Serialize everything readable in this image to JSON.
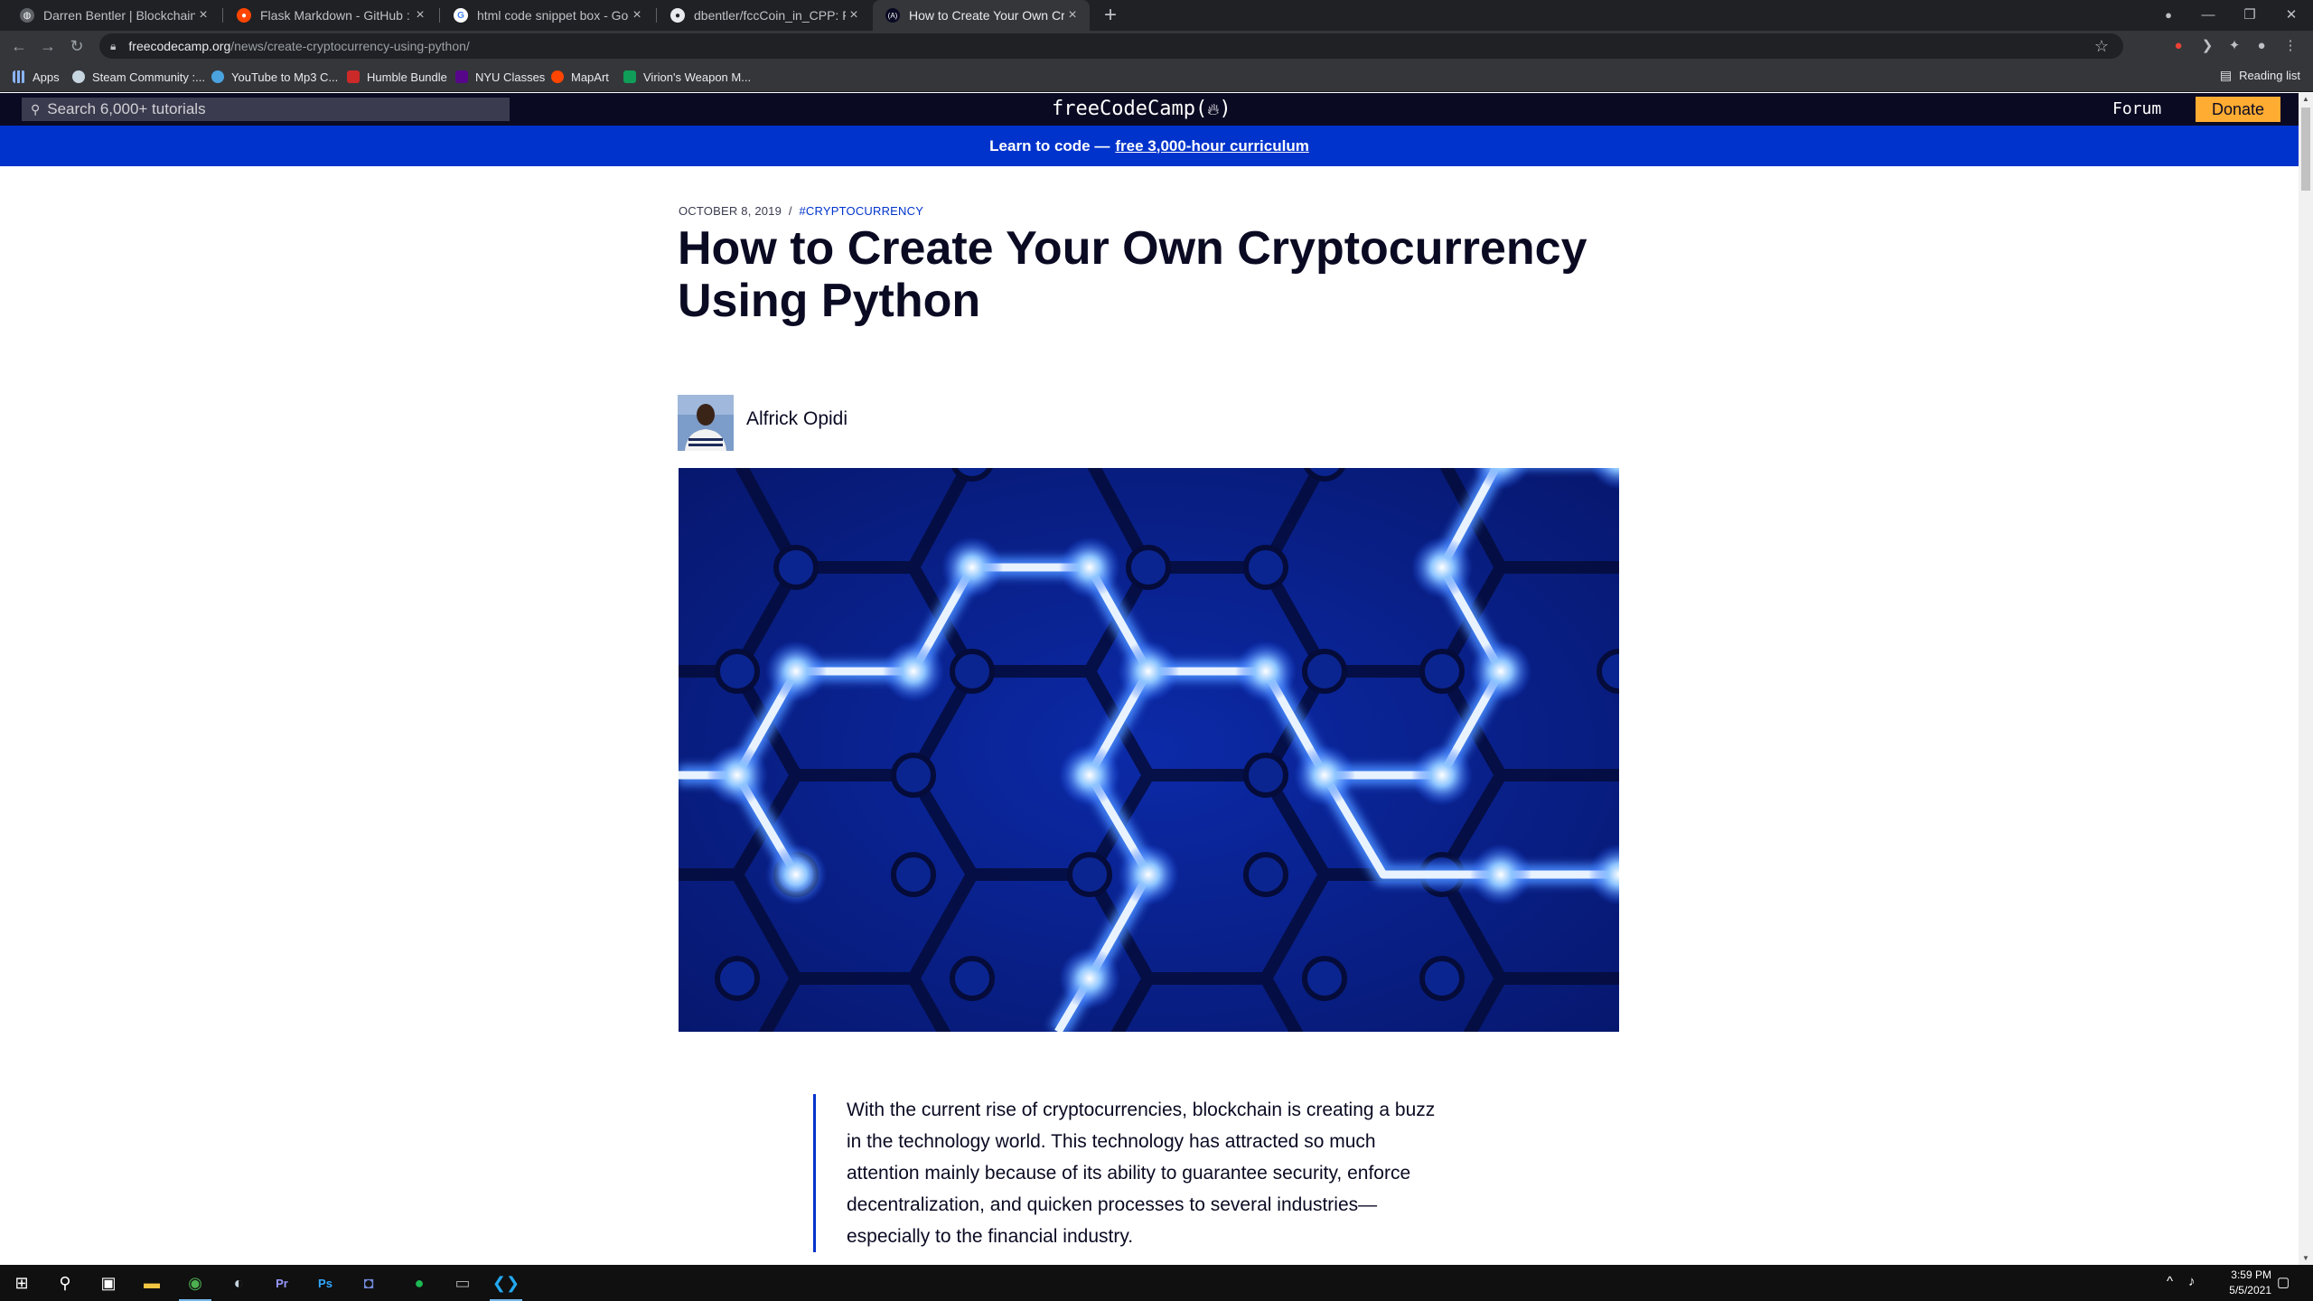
{
  "browser": {
    "tabs": [
      {
        "title": "Darren Bentler | Blockchain",
        "icon": "globe-icon"
      },
      {
        "title": "Flask Markdown - GitHub : flask",
        "icon": "reddit-icon"
      },
      {
        "title": "html code snippet box - Google",
        "icon": "google-icon"
      },
      {
        "title": "dbentler/fccCoin_in_CPP: Free Co",
        "icon": "github-icon"
      },
      {
        "title": "How to Create Your Own Crypto",
        "icon": "fcc-icon"
      }
    ],
    "url_host": "freecodecamp.org",
    "url_path": "/news/create-cryptocurrency-using-python/",
    "bookmarks": [
      {
        "label": "Apps",
        "icon": "apps-grid-icon"
      },
      {
        "label": "Steam Community :...",
        "icon": "steam-icon"
      },
      {
        "label": "YouTube to Mp3 C...",
        "icon": "youtube-mp3-icon"
      },
      {
        "label": "Humble Bundle",
        "icon": "humble-bundle-icon"
      },
      {
        "label": "NYU Classes",
        "icon": "nyu-icon"
      },
      {
        "label": "MapArt",
        "icon": "reddit-icon"
      },
      {
        "label": "Virion's Weapon M...",
        "icon": "sheets-icon"
      }
    ],
    "reading_list": "Reading list"
  },
  "site": {
    "search_placeholder": "Search 6,000+ tutorials",
    "logo": "freeCodeCamp(🔥)",
    "logo_text": "freeCodeCamp(",
    "logo_end": ")",
    "forum": "Forum",
    "donate": "Donate",
    "banner_prefix": "Learn to code —",
    "banner_link": "free 3,000-hour curriculum"
  },
  "article": {
    "date": "OCTOBER 8, 2019",
    "separator": "/",
    "tag": "#CRYPTOCURRENCY",
    "title": "How to Create Your Own Cryptocurrency Using Python",
    "author": "Alfrick Opidi",
    "intro": "With the current rise of cryptocurrencies, blockchain is creating a buzz in the technology world. This technology has attracted so much attention mainly because of its ability to guarantee security, enforce decentralization, and quicken processes to several industries—especially to the financial industry."
  },
  "taskbar": {
    "time": "3:59 PM",
    "date": "5/5/2021"
  },
  "colors": {
    "fcc_dark": "#0a0a23",
    "banner_blue": "#0033cc",
    "donate_yellow": "#feac32"
  }
}
